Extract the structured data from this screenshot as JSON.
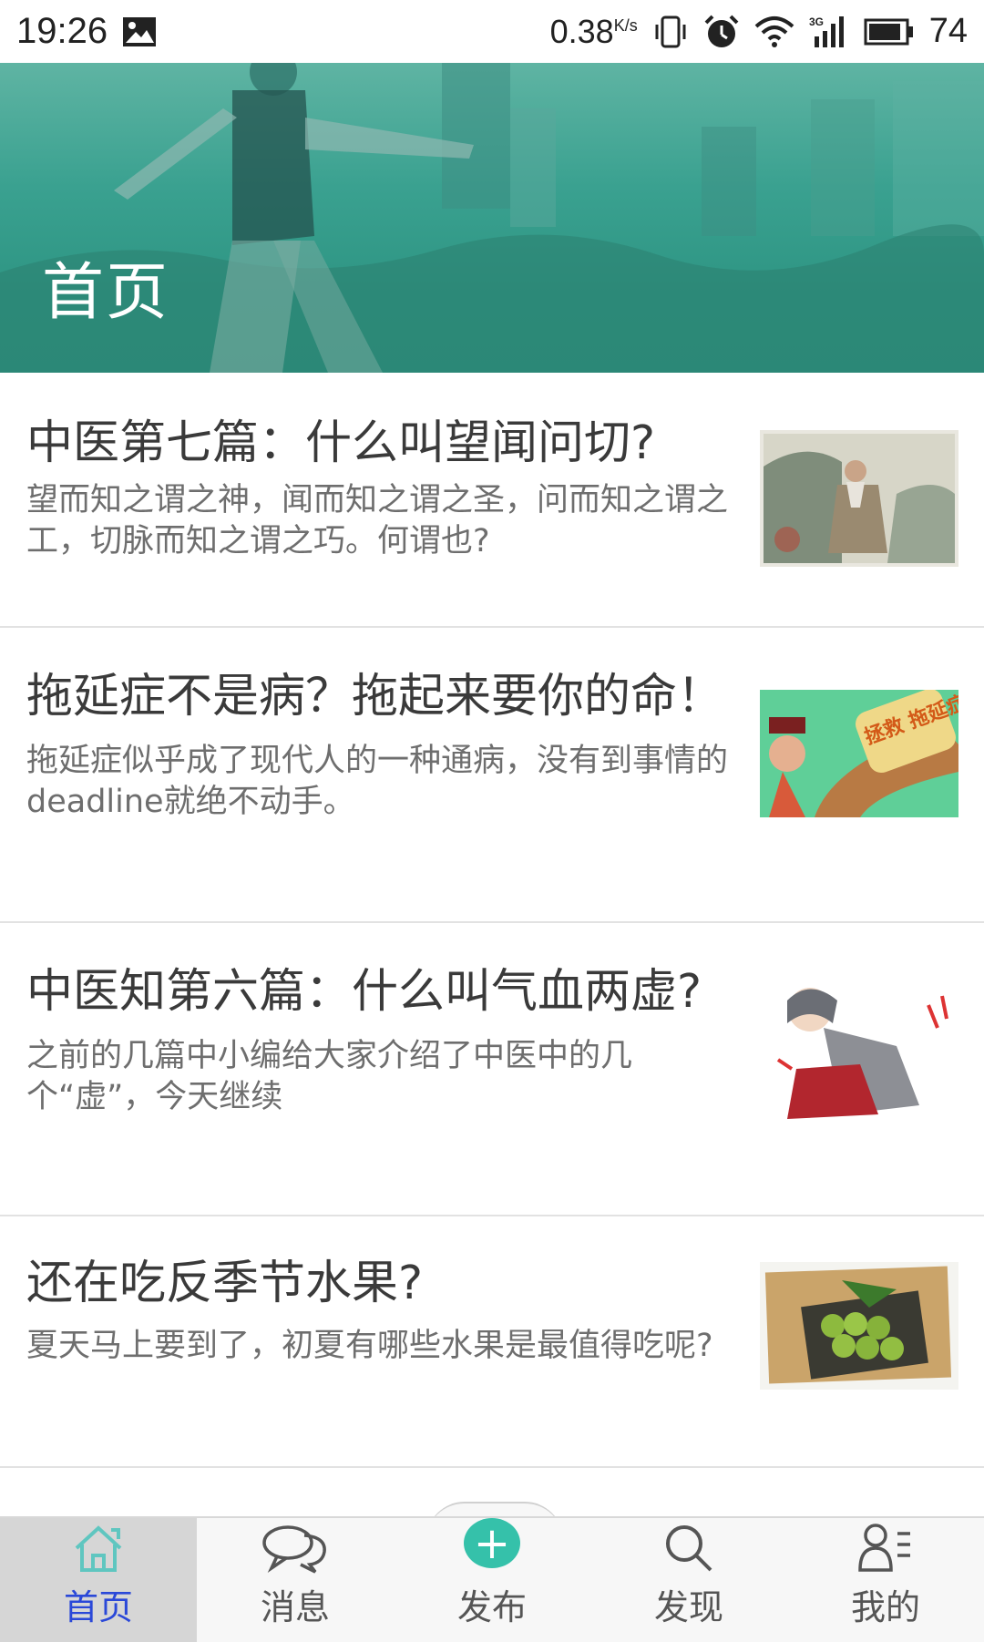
{
  "status_bar": {
    "time": "19:26",
    "net_speed": "0.38",
    "net_unit": "K/s",
    "battery": "74"
  },
  "header": {
    "title": "首页"
  },
  "articles": [
    {
      "title": "中医第七篇：什么叫望闻问切?",
      "summary": "望而知之谓之神，闻而知之谓之圣，问而知之谓之工，切脉而知之谓之巧。何谓也?"
    },
    {
      "title": "拖延症不是病？拖起来要你的命！",
      "summary": "拖延症似乎成了现代人的一种通病，没有到事情的deadline就绝不动手。",
      "thumb_text": "拯救 拖延症"
    },
    {
      "title": "中医知第六篇：什么叫气血两虚?",
      "summary": "之前的几篇中小编给大家介绍了中医中的几个“虚”，今天继续"
    },
    {
      "title": "还在吃反季节水果?",
      "summary": "夏天马上要到了，初夏有哪些水果是最值得吃呢?"
    }
  ],
  "bottom_nav": {
    "items": [
      {
        "label": "首页",
        "icon": "home-icon",
        "active": true
      },
      {
        "label": "消息",
        "icon": "chat-icon",
        "active": false
      },
      {
        "label": "发布",
        "icon": "plus-icon",
        "active": false
      },
      {
        "label": "发现",
        "icon": "search-icon",
        "active": false
      },
      {
        "label": "我的",
        "icon": "profile-icon",
        "active": false
      }
    ]
  },
  "colors": {
    "header_teal": "#2e9583",
    "publish_green": "#35c1aa",
    "active_nav_text": "#2a48d8"
  }
}
